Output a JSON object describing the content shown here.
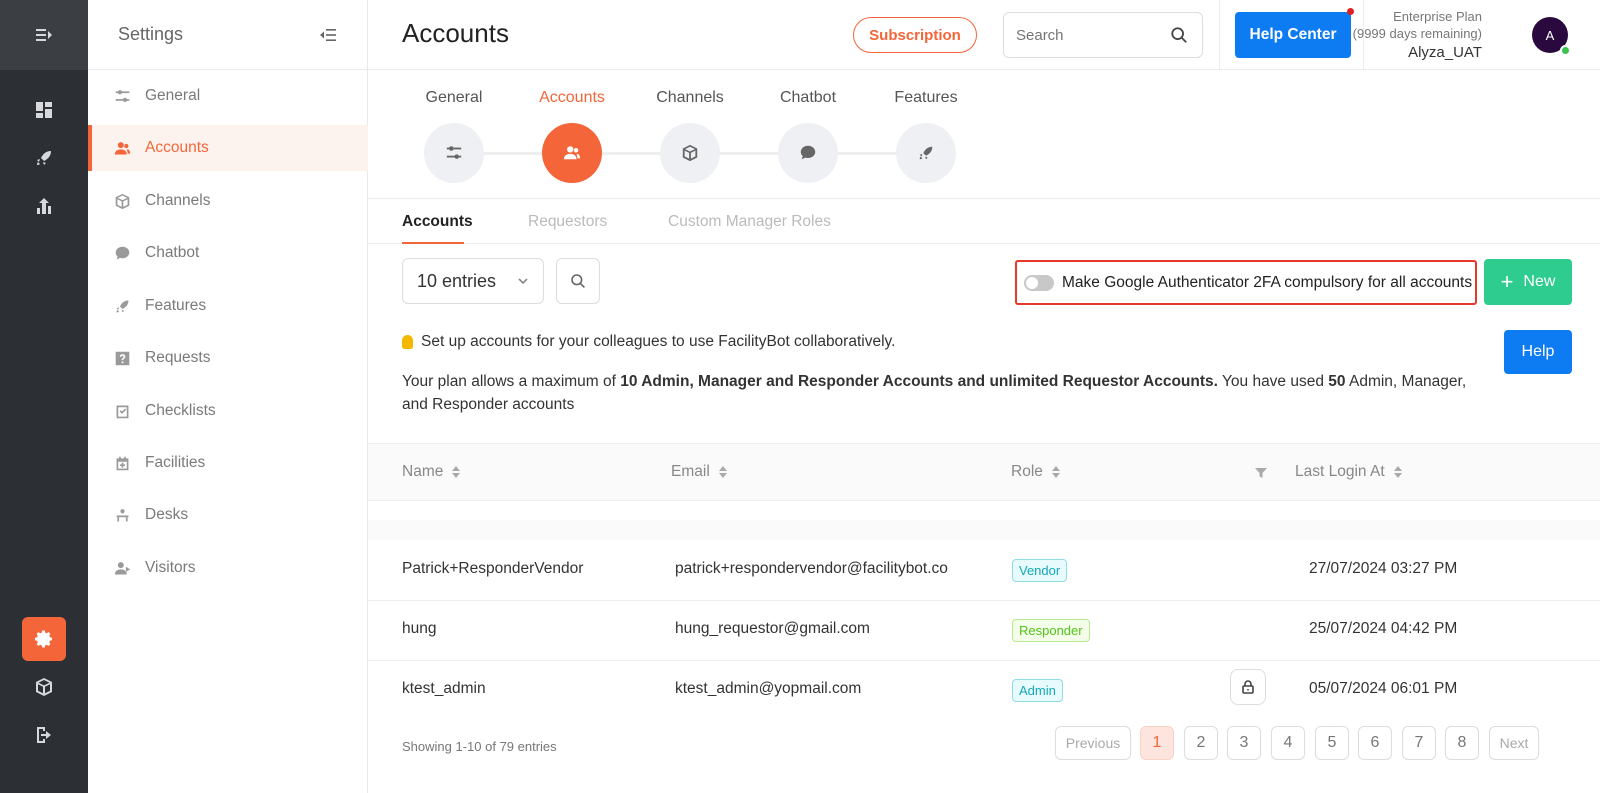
{
  "rail": {
    "items": [
      "menu-toggle",
      "dashboard",
      "rocket",
      "analytics",
      "settings",
      "box",
      "logout"
    ]
  },
  "sidebar": {
    "title": "Settings",
    "items": [
      {
        "label": "General",
        "icon": "sliders-icon"
      },
      {
        "label": "Accounts",
        "icon": "users-icon"
      },
      {
        "label": "Channels",
        "icon": "cube-icon"
      },
      {
        "label": "Chatbot",
        "icon": "chat-icon"
      },
      {
        "label": "Features",
        "icon": "rocket-icon"
      },
      {
        "label": "Requests",
        "icon": "question-icon"
      },
      {
        "label": "Checklists",
        "icon": "checklist-icon"
      },
      {
        "label": "Facilities",
        "icon": "calendar-plus-icon"
      },
      {
        "label": "Desks",
        "icon": "desk-icon"
      },
      {
        "label": "Visitors",
        "icon": "visitor-icon"
      }
    ]
  },
  "header": {
    "title": "Accounts",
    "subscription_label": "Subscription",
    "search_placeholder": "Search",
    "help_center_label": "Help Center",
    "plan_name": "Enterprise Plan",
    "plan_remaining": "(9999 days remaining)",
    "user_name": "Alyza_UAT",
    "avatar_initial": "A"
  },
  "steps": [
    {
      "label": "General"
    },
    {
      "label": "Accounts"
    },
    {
      "label": "Channels"
    },
    {
      "label": "Chatbot"
    },
    {
      "label": "Features"
    }
  ],
  "tabs": [
    "Accounts",
    "Requestors",
    "Custom Manager Roles"
  ],
  "toolbar": {
    "entries": "10 entries",
    "twofa_label": "Make Google Authenticator 2FA compulsory for all accounts",
    "twofa_enabled": false,
    "new_label": "New"
  },
  "info": {
    "tip": "Set up accounts for your colleagues to use FacilityBot collaboratively.",
    "plan_prefix": "Your plan allows a maximum of ",
    "plan_bold": "10 Admin, Manager and Responder Accounts and unlimited Requestor Accounts.",
    "plan_mid": " You have used ",
    "plan_used": "50",
    "plan_suffix": " Admin, Manager, and Responder accounts",
    "help_label": "Help"
  },
  "table": {
    "columns": [
      "Name",
      "Email",
      "Role",
      "Last Login At"
    ],
    "rows": [
      {
        "name": "Patrick+ResponderVendor",
        "email": "patrick+respondervendor@facilitybot.co",
        "role": "Vendor",
        "last_login": "27/07/2024 03:27 PM"
      },
      {
        "name": "hung",
        "email": "hung_requestor@gmail.com",
        "role": "Responder",
        "last_login": "25/07/2024 04:42 PM"
      },
      {
        "name": "ktest_admin",
        "email": "ktest_admin@yopmail.com",
        "role": "Admin",
        "last_login": "05/07/2024 06:01 PM"
      }
    ]
  },
  "pagination": {
    "showing": "Showing 1-10 of 79 entries",
    "previous": "Previous",
    "pages": [
      "1",
      "2",
      "3",
      "4",
      "5",
      "6",
      "7",
      "8"
    ],
    "current": "1",
    "next": "Next"
  },
  "colors": {
    "accent": "#f4663a",
    "primary": "#0d7bf2",
    "success": "#2ecc8f",
    "rail": "#2c2f33"
  }
}
